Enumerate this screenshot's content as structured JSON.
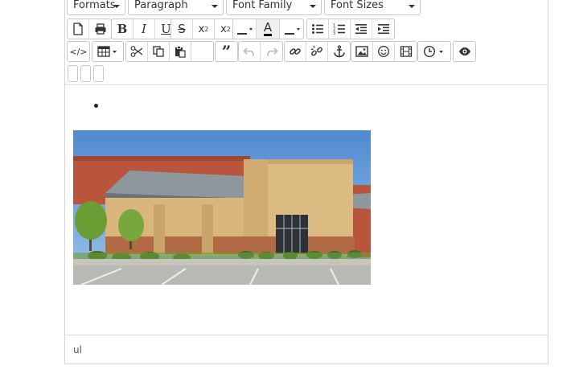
{
  "toolbar": {
    "formats_label": "Formats",
    "block_format_label": "Paragraph",
    "font_family_label": "Font Family",
    "font_size_label": "Font Sizes",
    "text_color_glyph": "A"
  },
  "status": {
    "path": "ul"
  },
  "colors": {
    "sky": "#5b93d3",
    "brick": "#b5523a",
    "tan": "#d9b57a",
    "roof": "#8c9396",
    "lawn": "#6e9e3b"
  }
}
